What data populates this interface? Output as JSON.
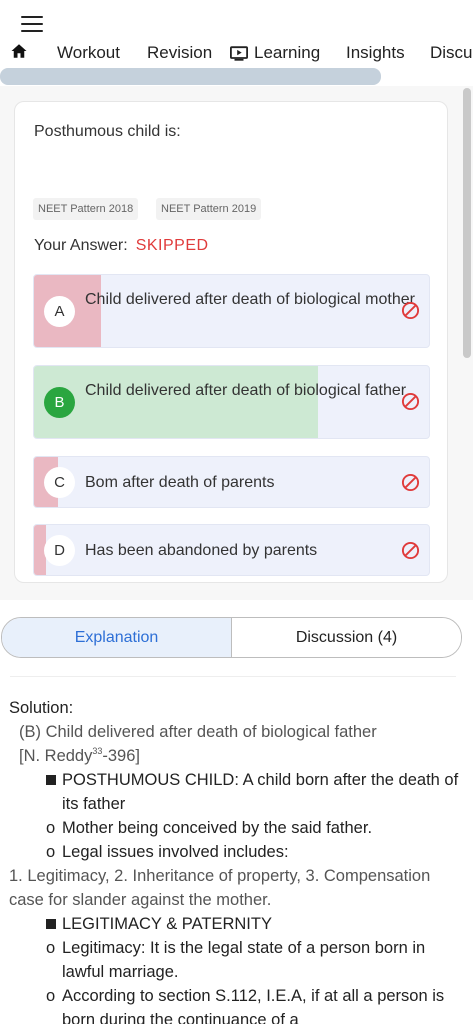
{
  "nav": {
    "items": [
      "Workout",
      "Revision",
      "Learning",
      "Insights",
      "Discu"
    ]
  },
  "question": {
    "text": "Posthumous child is:",
    "tags": [
      "NEET Pattern 2018",
      "NEET Pattern 2019"
    ],
    "answer_label": "Your Answer:",
    "answer_value": "SKIPPED"
  },
  "options": [
    {
      "letter": "A",
      "text": "Child delivered after death of biological mother",
      "fill_fraction": 0.17,
      "fill_color": "#eab8c2",
      "correct": false
    },
    {
      "letter": "B",
      "text": "Child delivered after death of biological father",
      "fill_fraction": 0.72,
      "fill_color": "#cde9d3",
      "correct": true
    },
    {
      "letter": "C",
      "text": "Bom after death of parents",
      "fill_fraction": 0.06,
      "fill_color": "#eab8c2",
      "correct": false
    },
    {
      "letter": "D",
      "text": "Has been abandoned by parents",
      "fill_fraction": 0.03,
      "fill_color": "#eab8c2",
      "correct": false
    }
  ],
  "tabs": {
    "explanation": "Explanation",
    "discussion": "Discussion (4)"
  },
  "solution": {
    "heading": "Solution:",
    "answer": "(B) Child delivered after death of biological father",
    "ref_prefix": "[N. Reddy",
    "ref_sup": "33",
    "ref_suffix": "-396]",
    "b1": "POSTHUMOUS CHILD: A child born after the death of its father",
    "b2": "Mother being conceived by the said father.",
    "b3": "Legal issues involved includes:",
    "p1": "1. Legitimacy, 2. Inheritance of property, 3. Compensation case for slander against the mother.",
    "b4": "LEGITIMACY & PATERNITY",
    "b5": "Legitimacy: It is the legal state of a person born in lawful marriage.",
    "b6": "According to section S.112, I.E.A, if at all a person is born during the continuance of a"
  },
  "colors": {
    "accent": "#2d6fd6",
    "skipped": "#e03b3b",
    "correct": "#2aa640",
    "wrong_fill": "#eab8c2",
    "correct_fill": "#cde9d3"
  }
}
